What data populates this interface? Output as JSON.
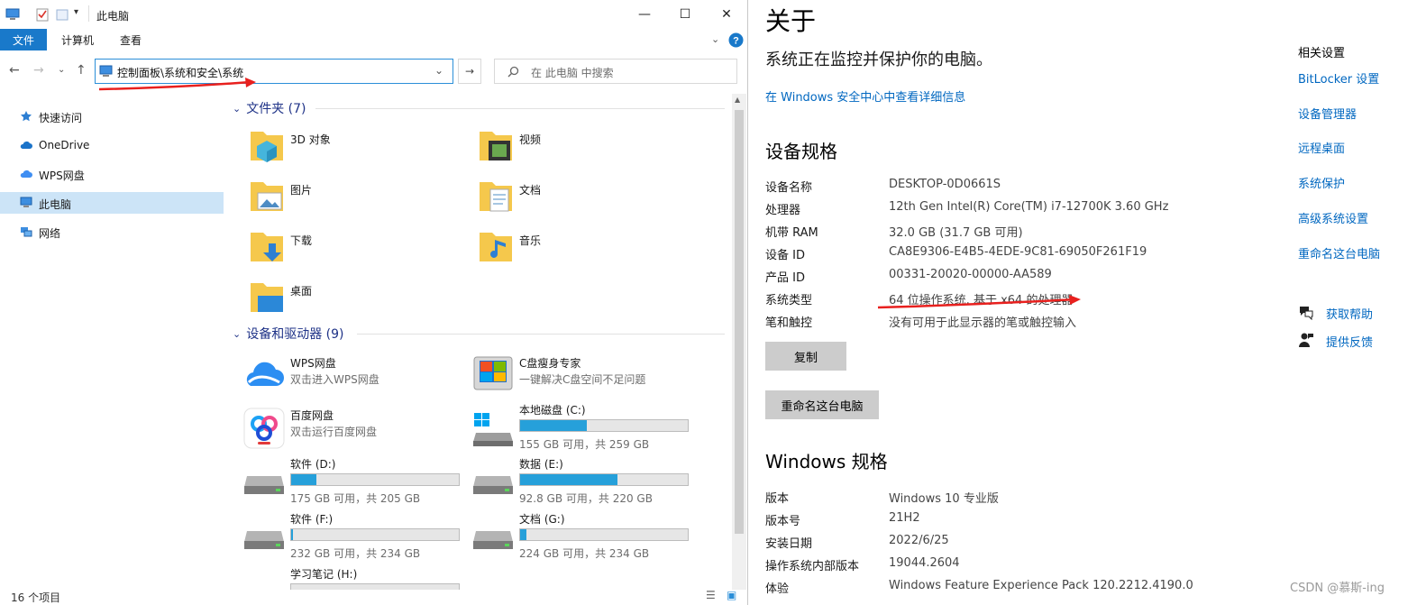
{
  "explorer": {
    "title": "此电脑",
    "ribbon": {
      "file": "文件",
      "computer": "计算机",
      "view": "查看"
    },
    "address": "控制面板\\系统和安全\\系统",
    "search_placeholder": "在 此电脑 中搜索",
    "sidebar": [
      {
        "label": "快速访问",
        "icon": "star-icon"
      },
      {
        "label": "OneDrive",
        "icon": "cloud-icon"
      },
      {
        "label": "WPS网盘",
        "icon": "wps-cloud-icon"
      },
      {
        "label": "此电脑",
        "icon": "computer-icon",
        "selected": true
      },
      {
        "label": "网络",
        "icon": "network-icon"
      }
    ],
    "groups": {
      "folders": "文件夹 (7)",
      "devices": "设备和驱动器 (9)"
    },
    "folders": [
      {
        "name": "3D 对象",
        "icon": "3d-objects-folder-icon"
      },
      {
        "name": "视频",
        "icon": "videos-folder-icon"
      },
      {
        "name": "图片",
        "icon": "pictures-folder-icon"
      },
      {
        "name": "文档",
        "icon": "documents-folder-icon"
      },
      {
        "name": "下载",
        "icon": "downloads-folder-icon"
      },
      {
        "name": "音乐",
        "icon": "music-folder-icon"
      },
      {
        "name": "桌面",
        "icon": "desktop-folder-icon"
      }
    ],
    "devices": [
      {
        "name": "WPS网盘",
        "sub": "双击进入WPS网盘",
        "icon": "wps-cloud-icon"
      },
      {
        "name": "C盘瘦身专家",
        "sub": "一键解决C盘空间不足问题",
        "icon": "cleaner-app-icon"
      },
      {
        "name": "百度网盘",
        "sub": "双击运行百度网盘",
        "icon": "baidu-netdisk-icon"
      },
      {
        "name": "本地磁盘 (C:)",
        "free": "155 GB 可用，共 259 GB",
        "used_fraction": 0.4,
        "icon": "windows-drive-icon"
      },
      {
        "name": "软件 (D:)",
        "free": "175 GB 可用，共 205 GB",
        "used_fraction": 0.15,
        "icon": "drive-icon"
      },
      {
        "name": "数据 (E:)",
        "free": "92.8 GB 可用，共 220 GB",
        "used_fraction": 0.58,
        "icon": "drive-icon"
      },
      {
        "name": "软件 (F:)",
        "free": "232 GB 可用，共 234 GB",
        "used_fraction": 0.01,
        "icon": "drive-icon"
      },
      {
        "name": "文档 (G:)",
        "free": "224 GB 可用，共 234 GB",
        "used_fraction": 0.04,
        "icon": "drive-icon"
      },
      {
        "name": "学习笔记 (H:)",
        "icon": "drive-icon"
      }
    ],
    "status": "16 个项目"
  },
  "settings": {
    "title": "关于",
    "protect_text": "系统正在监控并保护你的电脑。",
    "security_link": "在 Windows 安全中心中查看详细信息",
    "device_specs_title": "设备规格",
    "device_specs": [
      {
        "label": "设备名称",
        "value": "DESKTOP-0D0661S"
      },
      {
        "label": "处理器",
        "value": "12th Gen Intel(R) Core(TM) i7-12700K   3.60 GHz"
      },
      {
        "label": "机带 RAM",
        "value": "32.0 GB (31.7 GB 可用)"
      },
      {
        "label": "设备 ID",
        "value": "CA8E9306-E4B5-4EDE-9C81-69050F261F19"
      },
      {
        "label": "产品 ID",
        "value": "00331-20020-00000-AA589"
      },
      {
        "label": "系统类型",
        "value": "64 位操作系统, 基于 x64 的处理器"
      },
      {
        "label": "笔和触控",
        "value": "没有可用于此显示器的笔或触控输入"
      }
    ],
    "copy_button": "复制",
    "rename_button": "重命名这台电脑",
    "windows_specs_title": "Windows 规格",
    "windows_specs": [
      {
        "label": "版本",
        "value": "Windows 10 专业版"
      },
      {
        "label": "版本号",
        "value": "21H2"
      },
      {
        "label": "安装日期",
        "value": "2022/6/25"
      },
      {
        "label": "操作系统内部版本",
        "value": "19044.2604"
      },
      {
        "label": "体验",
        "value": "Windows Feature Experience Pack 120.2212.4190.0"
      }
    ],
    "related_title": "相关设置",
    "related_links": [
      "BitLocker 设置",
      "设备管理器",
      "远程桌面",
      "系统保护",
      "高级系统设置",
      "重命名这台电脑"
    ],
    "help_links": [
      {
        "label": "获取帮助",
        "icon": "help-chat-icon"
      },
      {
        "label": "提供反馈",
        "icon": "feedback-icon"
      }
    ],
    "watermark": "CSDN @慕斯-ing"
  },
  "colors": {
    "accent": "#1979ca",
    "link": "#0067c0",
    "drive_fill": "#26a0da",
    "annotation_arrow": "#e8201e"
  }
}
